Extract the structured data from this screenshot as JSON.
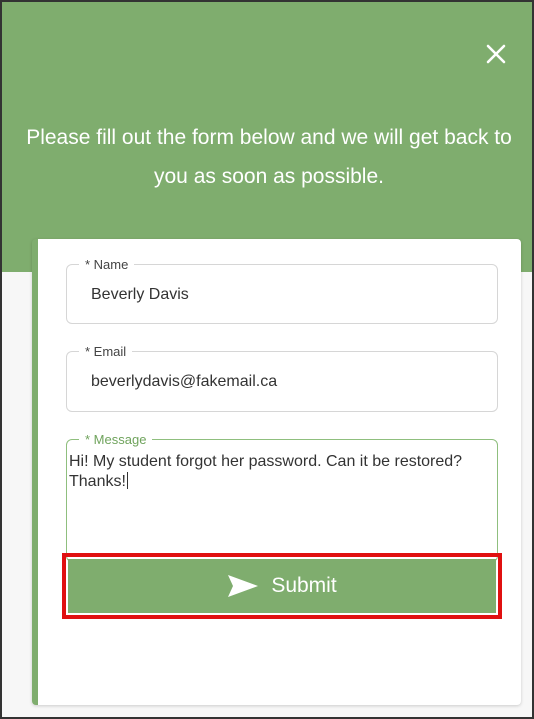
{
  "header": {
    "intro": "Please fill out the form below and we will get back to you as soon as possible.",
    "close_icon": "close-icon"
  },
  "form": {
    "name": {
      "label": "* Name",
      "value": "Beverly Davis"
    },
    "email": {
      "label": "* Email",
      "value": "beverlydavis@fakemail.ca"
    },
    "message": {
      "label": "* Message",
      "value": "Hi! My student forgot her password. Can it be restored? Thanks!"
    },
    "submit": {
      "label": "Submit",
      "icon": "send-icon"
    }
  },
  "colors": {
    "accent_green": "#7fad6e",
    "active_border": "#8fbf7e",
    "highlight_red": "#e01010"
  }
}
